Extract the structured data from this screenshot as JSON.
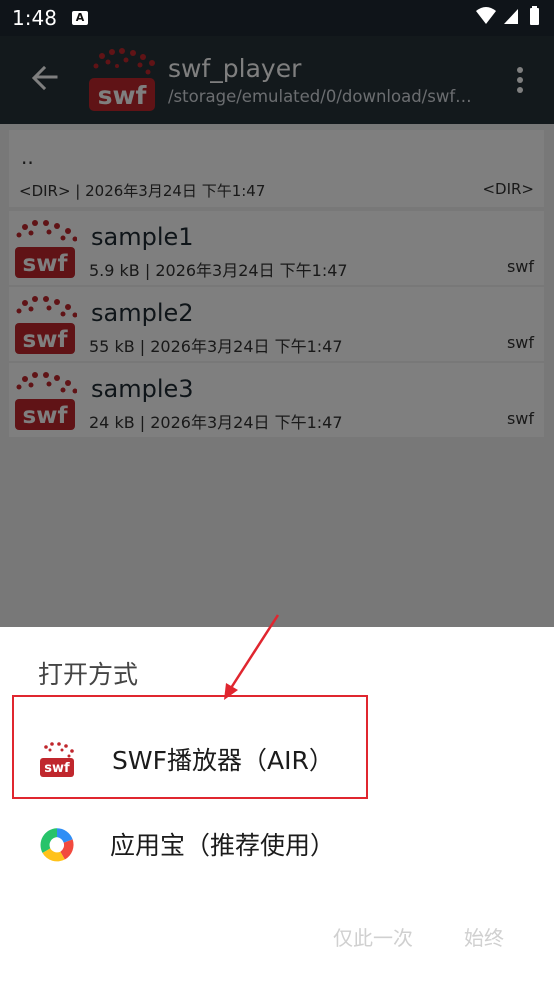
{
  "status_bar": {
    "time": "1:48",
    "notification_icon": "A"
  },
  "app_bar": {
    "title": "swf_player",
    "path": "/storage/emulated/0/download/swf…"
  },
  "file_list": {
    "parent": {
      "name": "..",
      "meta": "<DIR> | 2026年3月24日 下午1:47",
      "type": "<DIR>"
    },
    "files": [
      {
        "name": "sample1",
        "meta": "5.9 kB | 2026年3月24日 下午1:47",
        "type": "swf"
      },
      {
        "name": "sample2",
        "meta": "55 kB | 2026年3月24日 下午1:47",
        "type": "swf"
      },
      {
        "name": "sample3",
        "meta": "24 kB | 2026年3月24日 下午1:47",
        "type": "swf"
      }
    ]
  },
  "logo_text": "swf",
  "chooser": {
    "title": "打开方式",
    "options": [
      {
        "label": "SWF播放器（AIR）",
        "icon": "swf-player-icon"
      },
      {
        "label": "应用宝（推荐使用）",
        "icon": "yingyongbao-icon"
      }
    ],
    "just_once": "仅此一次",
    "always": "始终"
  },
  "colors": {
    "app_bar": "#263238",
    "status_bar": "#0f1419",
    "annotation": "#e0262f",
    "swf_red": "#c0272d"
  }
}
